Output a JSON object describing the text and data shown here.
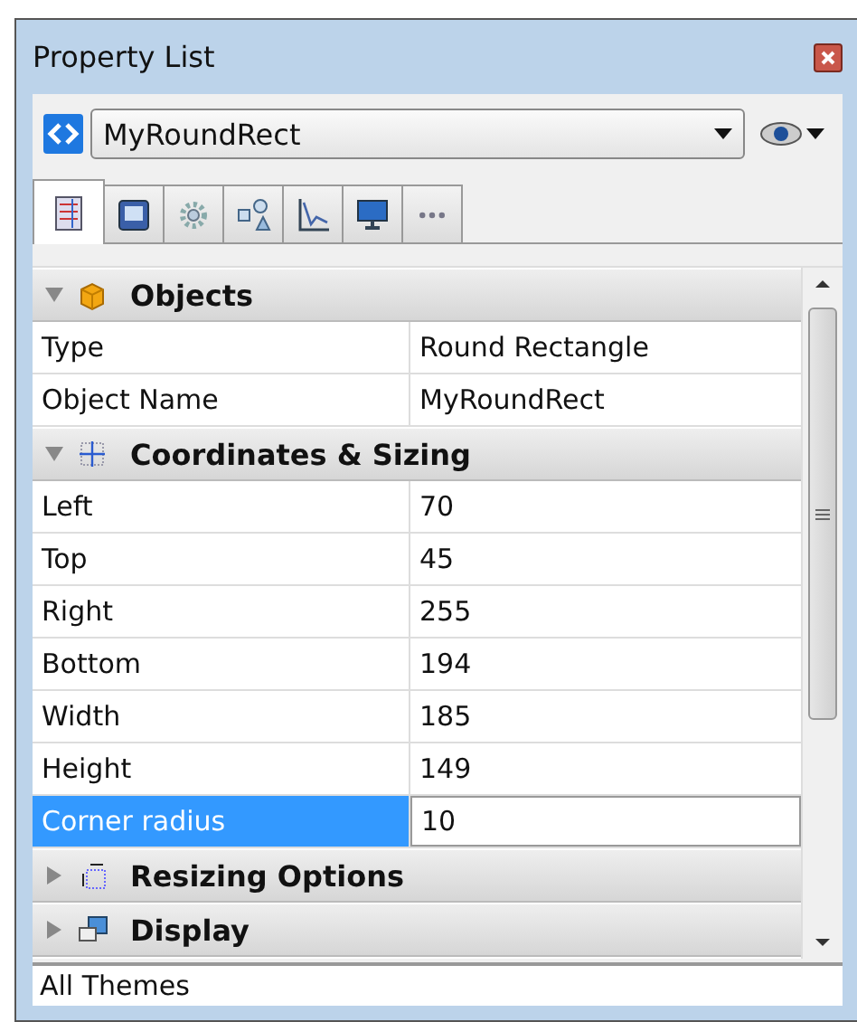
{
  "window": {
    "title": "Property List"
  },
  "object_selector": {
    "value": "MyRoundRect"
  },
  "tabs": [
    {
      "selected": true
    },
    {
      "selected": false
    },
    {
      "selected": false
    },
    {
      "selected": false
    },
    {
      "selected": false
    },
    {
      "selected": false
    },
    {
      "selected": false
    }
  ],
  "categories": [
    {
      "name": "Objects",
      "expanded": true,
      "rows": [
        {
          "name": "Type",
          "value": "Round Rectangle",
          "selected": false
        },
        {
          "name": "Object Name",
          "value": "MyRoundRect",
          "selected": false
        }
      ]
    },
    {
      "name": "Coordinates & Sizing",
      "expanded": true,
      "rows": [
        {
          "name": "Left",
          "value": "70",
          "selected": false
        },
        {
          "name": "Top",
          "value": "45",
          "selected": false
        },
        {
          "name": "Right",
          "value": "255",
          "selected": false
        },
        {
          "name": "Bottom",
          "value": "194",
          "selected": false
        },
        {
          "name": "Width",
          "value": "185",
          "selected": false
        },
        {
          "name": "Height",
          "value": "149",
          "selected": false
        },
        {
          "name": "Corner radius",
          "value": "10",
          "selected": true
        }
      ]
    },
    {
      "name": "Resizing Options",
      "expanded": false
    },
    {
      "name": "Display",
      "expanded": false
    }
  ],
  "status_bar": {
    "text": "All Themes"
  }
}
